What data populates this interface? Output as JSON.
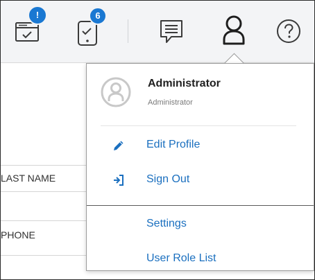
{
  "header": {
    "notifications_badge": "!",
    "mobile_badge": "6",
    "badge_color": "#1a78d2",
    "icon_color": "#3a3a3a"
  },
  "table": {
    "columns": [
      "LAST NAME",
      "PHONE"
    ]
  },
  "user_menu": {
    "name": "Administrator",
    "role": "Administrator",
    "link_color": "#1a6fbf",
    "items": [
      {
        "label": "Edit Profile",
        "icon": "pencil-icon"
      },
      {
        "label": "Sign Out",
        "icon": "sign-out-icon"
      },
      {
        "label": "Settings",
        "icon": ""
      },
      {
        "label": "User Role List",
        "icon": ""
      }
    ]
  }
}
